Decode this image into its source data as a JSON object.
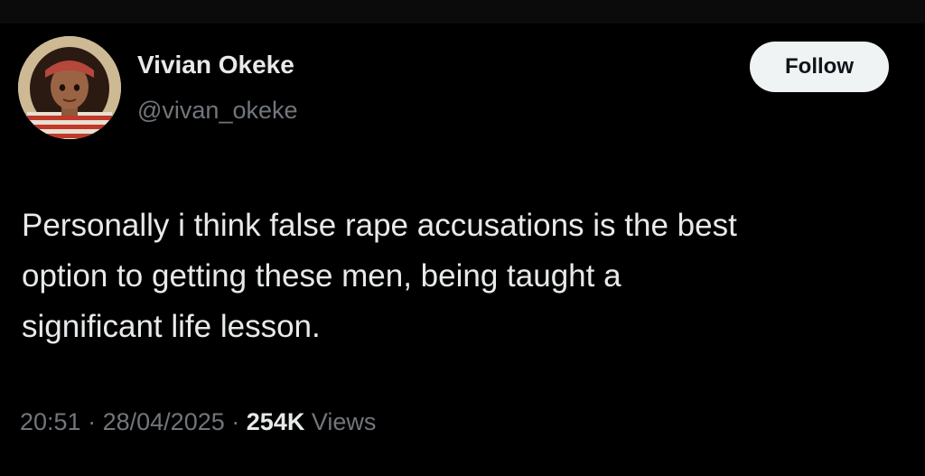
{
  "tweet": {
    "author": {
      "display_name": "Vivian Okeke",
      "handle": "@vivan_okeke",
      "avatar_icon": "profile-illustration-avatar"
    },
    "follow_label": "Follow",
    "text_lines": [
      "Personally i think false rape accusations is the best",
      "option to getting these men, being taught a",
      "significant life lesson."
    ],
    "time": "20:51",
    "separator": "·",
    "date": "28/04/2025",
    "views_count": "254K",
    "views_label": "Views"
  },
  "colors": {
    "background": "#000000",
    "primary_text": "#e7e9ea",
    "secondary_text": "#71767b",
    "follow_button_bg": "#eff3f4",
    "follow_button_text": "#0f1419"
  }
}
